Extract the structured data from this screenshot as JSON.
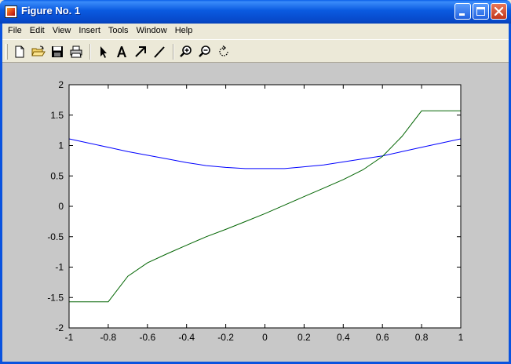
{
  "window": {
    "title": "Figure No. 1",
    "accent_color": "#0a53df",
    "buttons": [
      "minimize-icon",
      "maximize-icon",
      "close-icon"
    ]
  },
  "menubar": {
    "items": [
      "File",
      "Edit",
      "View",
      "Insert",
      "Tools",
      "Window",
      "Help"
    ]
  },
  "toolbar": {
    "tools": [
      {
        "name": "new-figure-button",
        "icon": "new-document-icon"
      },
      {
        "name": "open-file-button",
        "icon": "open-folder-icon"
      },
      {
        "name": "save-button",
        "icon": "floppy-disk-icon"
      },
      {
        "name": "print-button",
        "icon": "printer-icon"
      },
      {
        "name": "edit-plot-button",
        "icon": "pointer-arrow-icon"
      },
      {
        "name": "insert-text-button",
        "icon": "text-a-icon"
      },
      {
        "name": "insert-arrow-button",
        "icon": "arrow-icon"
      },
      {
        "name": "insert-line-button",
        "icon": "line-icon"
      },
      {
        "name": "zoom-in-button",
        "icon": "zoom-in-icon"
      },
      {
        "name": "zoom-out-button",
        "icon": "zoom-out-icon"
      },
      {
        "name": "rotate-3d-button",
        "icon": "rotate-icon"
      }
    ]
  },
  "chart_data": {
    "type": "line",
    "title": "",
    "xlabel": "",
    "ylabel": "",
    "xlim": [
      -1,
      1
    ],
    "ylim": [
      -2,
      2
    ],
    "grid": false,
    "legend": "none",
    "x_ticks": [
      "-1",
      "-0.8",
      "-0.6",
      "-0.4",
      "-0.2",
      "0",
      "0.2",
      "0.4",
      "0.6",
      "0.8",
      "1"
    ],
    "y_ticks": [
      "2",
      "1.5",
      "1",
      "0.5",
      "0",
      "-0.5",
      "-1",
      "-1.5",
      "-2"
    ],
    "x_tick_values": [
      -1,
      -0.8,
      -0.6,
      -0.4,
      -0.2,
      0,
      0.2,
      0.4,
      0.6,
      0.8,
      1
    ],
    "y_tick_values": [
      2,
      1.5,
      1,
      0.5,
      0,
      -0.5,
      -1,
      -1.5,
      -2
    ],
    "series": [
      {
        "color": "#0000ff",
        "x": [
          -1,
          -0.9,
          -0.8,
          -0.7,
          -0.6,
          -0.5,
          -0.4,
          -0.3,
          -0.2,
          -0.1,
          0,
          0.1,
          0.2,
          0.3,
          0.4,
          0.5,
          0.6,
          0.7,
          0.8,
          0.9,
          1
        ],
        "y": [
          1.11,
          1.04,
          0.97,
          0.9,
          0.84,
          0.78,
          0.72,
          0.67,
          0.64,
          0.62,
          0.62,
          0.62,
          0.65,
          0.68,
          0.73,
          0.78,
          0.83,
          0.9,
          0.97,
          1.04,
          1.11
        ]
      },
      {
        "color": "#006400",
        "x": [
          -1,
          -0.8,
          -0.7,
          -0.6,
          -0.5,
          -0.4,
          -0.3,
          -0.2,
          -0.1,
          0,
          0.1,
          0.2,
          0.3,
          0.4,
          0.5,
          0.6,
          0.7,
          0.8,
          1
        ],
        "y": [
          -1.57,
          -1.57,
          -1.15,
          -0.93,
          -0.78,
          -0.64,
          -0.5,
          -0.38,
          -0.25,
          -0.12,
          0.02,
          0.16,
          0.3,
          0.44,
          0.6,
          0.82,
          1.15,
          1.57,
          1.57
        ]
      }
    ]
  }
}
